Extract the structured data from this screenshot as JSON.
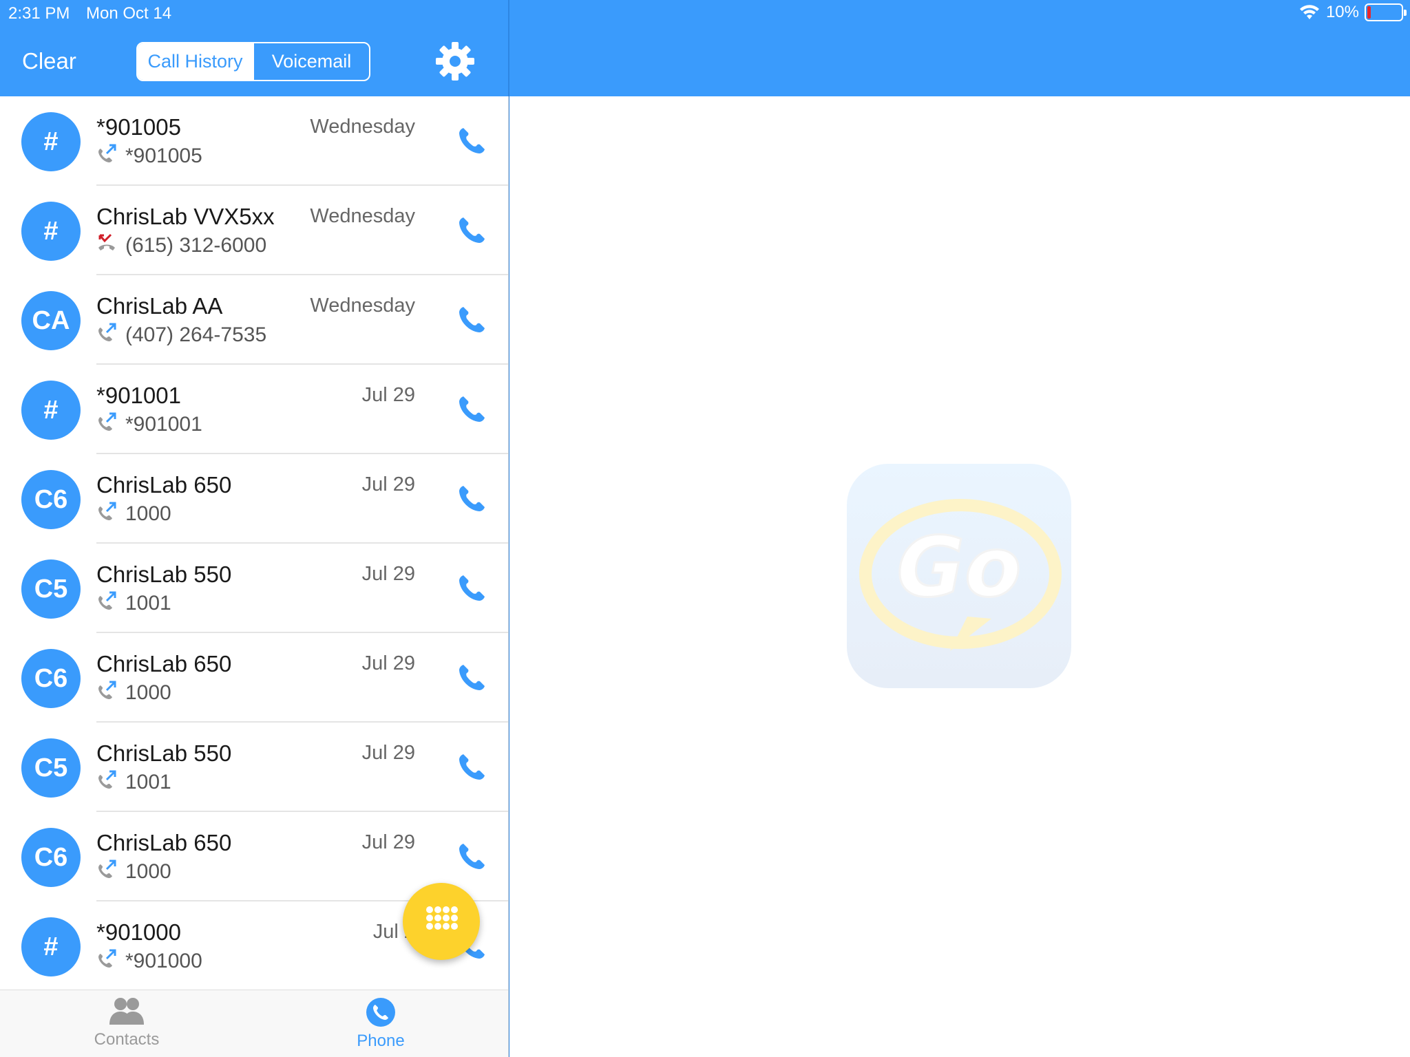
{
  "status": {
    "time": "2:31 PM",
    "date": "Mon Oct 14",
    "battery": "10%",
    "battery_level": 0.1
  },
  "header": {
    "clear_label": "Clear",
    "tabs": [
      {
        "label": "Call History",
        "active": true
      },
      {
        "label": "Voicemail",
        "active": false
      }
    ]
  },
  "calls": [
    {
      "avatar": "#",
      "name": "*901005",
      "number": "*901005",
      "date": "Wednesday",
      "direction": "outgoing"
    },
    {
      "avatar": "#",
      "name": "ChrisLab VVX5xx",
      "number": "(615) 312-6000",
      "date": "Wednesday",
      "direction": "missed"
    },
    {
      "avatar": "CA",
      "name": "ChrisLab AA",
      "number": "(407) 264-7535",
      "date": "Wednesday",
      "direction": "outgoing"
    },
    {
      "avatar": "#",
      "name": "*901001",
      "number": "*901001",
      "date": "Jul 29",
      "direction": "outgoing"
    },
    {
      "avatar": "C6",
      "name": "ChrisLab 650",
      "number": "1000",
      "date": "Jul 29",
      "direction": "outgoing"
    },
    {
      "avatar": "C5",
      "name": "ChrisLab 550",
      "number": "1001",
      "date": "Jul 29",
      "direction": "outgoing"
    },
    {
      "avatar": "C6",
      "name": "ChrisLab 650",
      "number": "1000",
      "date": "Jul 29",
      "direction": "outgoing"
    },
    {
      "avatar": "C5",
      "name": "ChrisLab 550",
      "number": "1001",
      "date": "Jul 29",
      "direction": "outgoing"
    },
    {
      "avatar": "C6",
      "name": "ChrisLab 650",
      "number": "1000",
      "date": "Jul 29",
      "direction": "outgoing"
    },
    {
      "avatar": "#",
      "name": "*901000",
      "number": "*901000",
      "date": "Jul 2",
      "direction": "outgoing"
    }
  ],
  "tabbar": {
    "contacts_label": "Contacts",
    "phone_label": "Phone"
  },
  "colors": {
    "brand": "#3a9bfc",
    "fab": "#fdd22c",
    "missed": "#d0202a"
  },
  "logo": {
    "text": "Go"
  }
}
